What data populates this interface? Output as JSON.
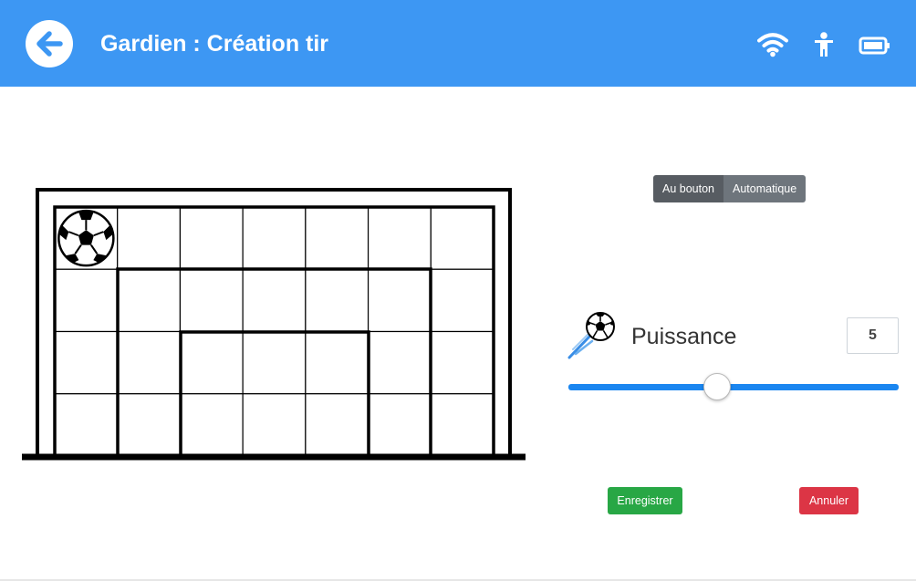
{
  "header": {
    "title": "Gardien : Création tir",
    "background_color": "#3d97f3",
    "back_icon": "arrow-left-icon",
    "status_icons": [
      "wifi-icon",
      "person-icon",
      "battery-icon"
    ]
  },
  "goal": {
    "rows": 4,
    "columns": 7,
    "ball_position": {
      "row": 1,
      "column": 1
    }
  },
  "mode": {
    "options": [
      "Au bouton",
      "Automatique"
    ],
    "selected": "Au bouton"
  },
  "power": {
    "label": "Puissance",
    "value": "5",
    "min": 0,
    "max": 10,
    "track_color": "#1a86f0"
  },
  "actions": {
    "save_label": "Enregistrer",
    "save_color": "#28a745",
    "cancel_label": "Annuler",
    "cancel_color": "#dc3545"
  }
}
